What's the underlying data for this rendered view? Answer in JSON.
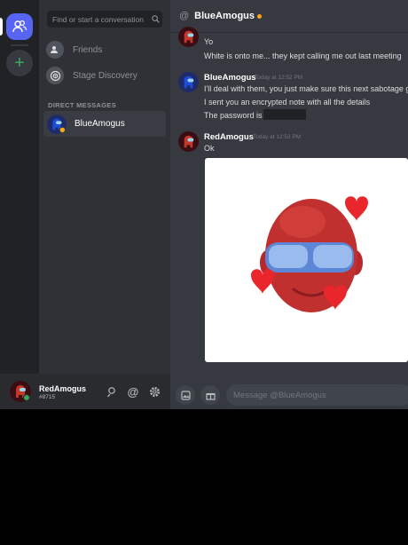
{
  "search": {
    "placeholder": "Find or start a conversation"
  },
  "nav": {
    "friends": "Friends",
    "stage": "Stage Discovery"
  },
  "dm": {
    "header": "DIRECT MESSAGES",
    "items": [
      {
        "name": "BlueAmogus"
      }
    ]
  },
  "user": {
    "name": "RedAmogus",
    "tag": "#8715"
  },
  "channel": {
    "title": "BlueAmogus"
  },
  "messages": [
    {
      "author": "",
      "time": "",
      "lines": [
        "Yo",
        "White is onto me... they kept calling me out last meeting"
      ]
    },
    {
      "author": "BlueAmogus",
      "time": "Today at 12:52 PM",
      "lines": [
        "I'll deal with them, you just make sure this next sabotage g",
        "I sent you an encrypted note with all the details",
        "The password is"
      ]
    },
    {
      "author": "RedAmogus",
      "time": "Today at 12:53 PM",
      "lines": [
        "Ok"
      ]
    }
  ],
  "composer": {
    "placeholder": "Message @BlueAmogus"
  },
  "colors": {
    "blurple": "#5865f2",
    "online": "#3ba55d",
    "idle": "#faa81a"
  }
}
